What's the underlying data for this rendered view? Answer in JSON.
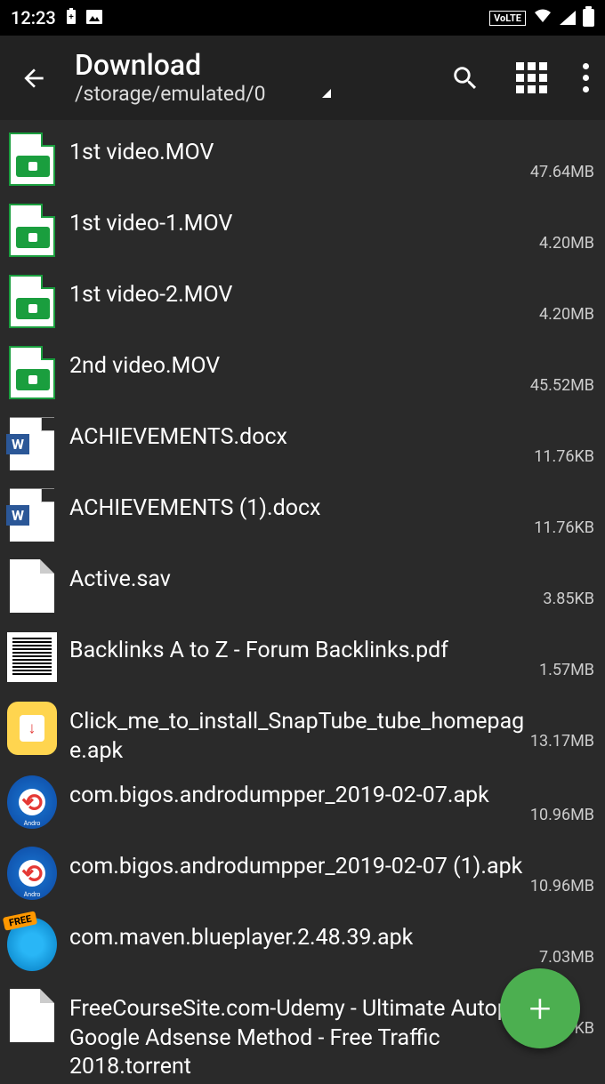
{
  "statusbar": {
    "time": "12:23",
    "volte": "VoLTE"
  },
  "appbar": {
    "title": "Download",
    "path": "/storage/emulated/0"
  },
  "files": [
    {
      "name": "1st video.MOV",
      "size": "47.64MB",
      "type": "video"
    },
    {
      "name": "1st video-1.MOV",
      "size": "4.20MB",
      "type": "video"
    },
    {
      "name": "1st video-2.MOV",
      "size": "4.20MB",
      "type": "video"
    },
    {
      "name": "2nd video.MOV",
      "size": "45.52MB",
      "type": "video"
    },
    {
      "name": "ACHIEVEMENTS.docx",
      "size": "11.76KB",
      "type": "word"
    },
    {
      "name": "ACHIEVEMENTS (1).docx",
      "size": "11.76KB",
      "type": "word"
    },
    {
      "name": "Active.sav",
      "size": "3.85KB",
      "type": "generic"
    },
    {
      "name": "Backlinks A to Z  - Forum Backlinks.pdf",
      "size": "1.57MB",
      "type": "pdf"
    },
    {
      "name": "Click_me_to_install_SnapTube_tube_homepage.apk",
      "size": "13.17MB",
      "type": "apk-yellow"
    },
    {
      "name": "com.bigos.androdumpper_2019-02-07.apk",
      "size": "10.96MB",
      "type": "apk-andro"
    },
    {
      "name": "com.bigos.androdumpper_2019-02-07 (1).apk",
      "size": "10.96MB",
      "type": "apk-andro"
    },
    {
      "name": "com.maven.blueplayer.2.48.39.apk",
      "size": "7.03MB",
      "type": "apk-blue"
    },
    {
      "name": "FreeCourseSite.com-Udemy - Ultimate Autopilot Google Adsense Method - Free Traffic 2018.torrent",
      "size": "9.60KB",
      "type": "generic"
    }
  ]
}
